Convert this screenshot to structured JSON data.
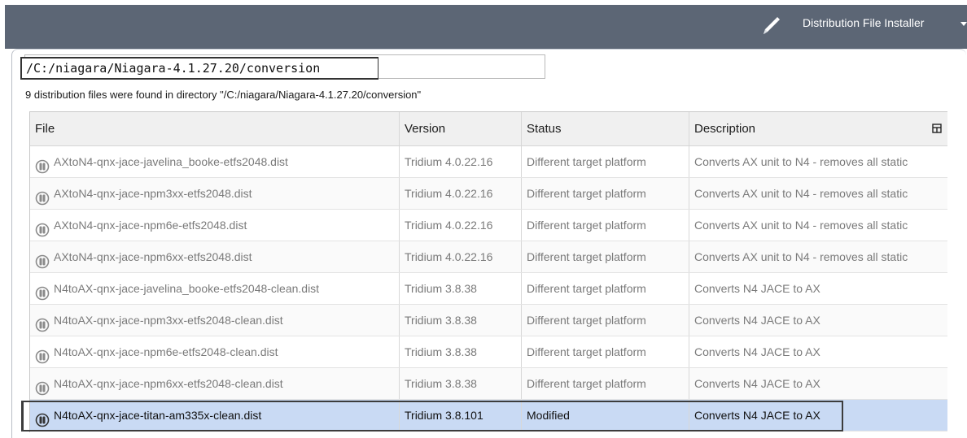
{
  "header": {
    "view_title": "Distribution File Installer",
    "edit_icon": "pencil-icon",
    "menu_icon": "chevron-down-icon"
  },
  "directory": {
    "path": "/C:/niagara/Niagara-4.1.27.20/conversion",
    "found_message": "9 distribution files were found in directory \"/C:/niagara/Niagara-4.1.27.20/conversion\""
  },
  "table": {
    "columns": [
      "File",
      "Version",
      "Status",
      "Description"
    ],
    "column_menu_icon": "column-chooser-icon",
    "rows": [
      {
        "file": "AXtoN4-qnx-jace-javelina_booke-etfs2048.dist",
        "version": "Tridium 4.0.22.16",
        "status": "Different target platform",
        "description": "Converts AX unit to N4 - removes all static"
      },
      {
        "file": "AXtoN4-qnx-jace-npm3xx-etfs2048.dist",
        "version": "Tridium 4.0.22.16",
        "status": "Different target platform",
        "description": "Converts AX unit to N4 - removes all static"
      },
      {
        "file": "AXtoN4-qnx-jace-npm6e-etfs2048.dist",
        "version": "Tridium 4.0.22.16",
        "status": "Different target platform",
        "description": "Converts AX unit to N4 - removes all static"
      },
      {
        "file": "AXtoN4-qnx-jace-npm6xx-etfs2048.dist",
        "version": "Tridium 4.0.22.16",
        "status": "Different target platform",
        "description": "Converts AX unit to N4 - removes all static"
      },
      {
        "file": "N4toAX-qnx-jace-javelina_booke-etfs2048-clean.dist",
        "version": "Tridium 3.8.38",
        "status": "Different target platform",
        "description": "Converts N4 JACE to AX"
      },
      {
        "file": "N4toAX-qnx-jace-npm3xx-etfs2048-clean.dist",
        "version": "Tridium 3.8.38",
        "status": "Different target platform",
        "description": "Converts N4 JACE to AX"
      },
      {
        "file": "N4toAX-qnx-jace-npm6e-etfs2048-clean.dist",
        "version": "Tridium 3.8.38",
        "status": "Different target platform",
        "description": "Converts N4 JACE to AX"
      },
      {
        "file": "N4toAX-qnx-jace-npm6xx-etfs2048-clean.dist",
        "version": "Tridium 3.8.38",
        "status": "Different target platform",
        "description": "Converts N4 JACE to AX"
      },
      {
        "file": "N4toAX-qnx-jace-titan-am335x-clean.dist",
        "version": "Tridium 3.8.101",
        "status": "Modified",
        "description": "Converts N4 JACE to AX",
        "selected": true
      }
    ]
  },
  "colors": {
    "toolbar": "#5c6675",
    "selection": "#c9daf4",
    "muted_text": "#7a7a7a"
  }
}
